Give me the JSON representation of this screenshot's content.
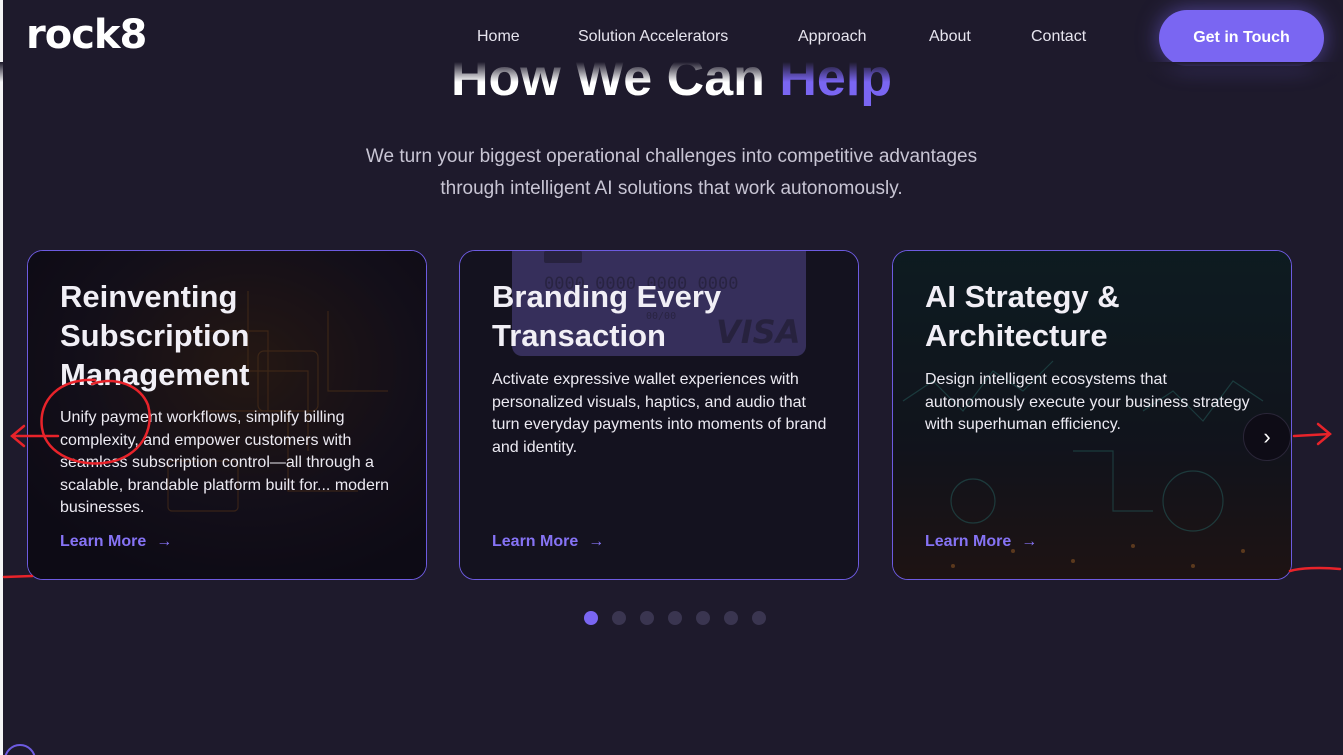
{
  "header": {
    "logo": "rock8",
    "nav": [
      {
        "label": "Home"
      },
      {
        "label": "Solution Accelerators"
      },
      {
        "label": "Approach"
      },
      {
        "label": "About"
      },
      {
        "label": "Contact"
      }
    ],
    "cta": "Get in Touch"
  },
  "section": {
    "title_main": "How We Can ",
    "title_accent": "Help",
    "subtitle_line1": "We turn your biggest operational challenges into competitive advantages",
    "subtitle_line2": "through intelligent AI solutions that work autonomously."
  },
  "cards": [
    {
      "title": "Reinventing Subscription Management",
      "description": "Unify payment workflows, simplify billing complexity, and empower customers with seamless subscription control—all through a scalable, brandable platform built for... modern businesses.",
      "link": "Learn More"
    },
    {
      "title": "Branding Every Transaction",
      "description": "Activate expressive wallet experiences with personalized visuals, haptics, and audio that turn everyday payments into moments of brand and identity.",
      "link": "Learn More",
      "card_image_text": {
        "number": "0000 0000 0000 0000",
        "expiry": "00/00",
        "brand": "VISA"
      }
    },
    {
      "title": "AI Strategy & Architecture",
      "description": "Design intelligent ecosystems that autonomously execute your business strategy with superhuman efficiency.",
      "link": "Learn More"
    }
  ],
  "carousel": {
    "total_pages": 7,
    "current_page": 1
  },
  "colors": {
    "background": "#1e1a2c",
    "accent": "#7a66f2",
    "annotation": "#e8232a"
  }
}
